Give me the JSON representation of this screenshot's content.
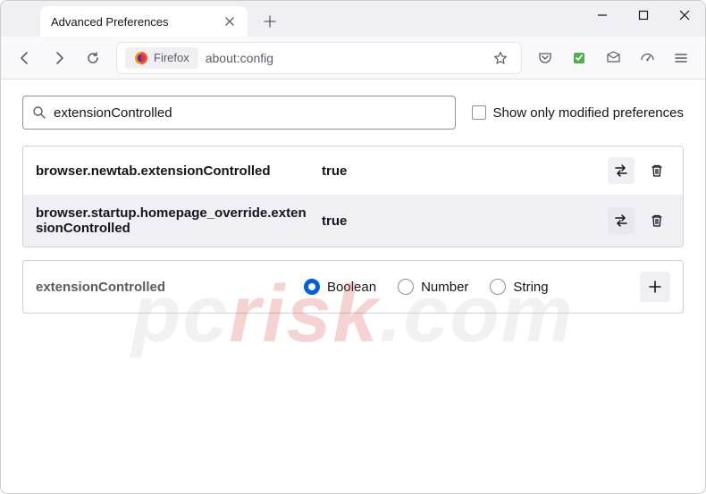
{
  "window": {
    "tab_title": "Advanced Preferences"
  },
  "urlbar": {
    "identity_label": "Firefox",
    "url": "about:config"
  },
  "search": {
    "value": "extensionControlled",
    "show_modified_label": "Show only modified preferences"
  },
  "prefs": [
    {
      "name": "browser.newtab.extensionControlled",
      "value": "true"
    },
    {
      "name": "browser.startup.homepage_override.extensionControlled",
      "value": "true"
    }
  ],
  "new_pref": {
    "name": "extensionControlled",
    "types": [
      "Boolean",
      "Number",
      "String"
    ],
    "selected": "Boolean"
  },
  "watermark": {
    "pre": "pc",
    "em": "risk",
    "post": ".com"
  }
}
